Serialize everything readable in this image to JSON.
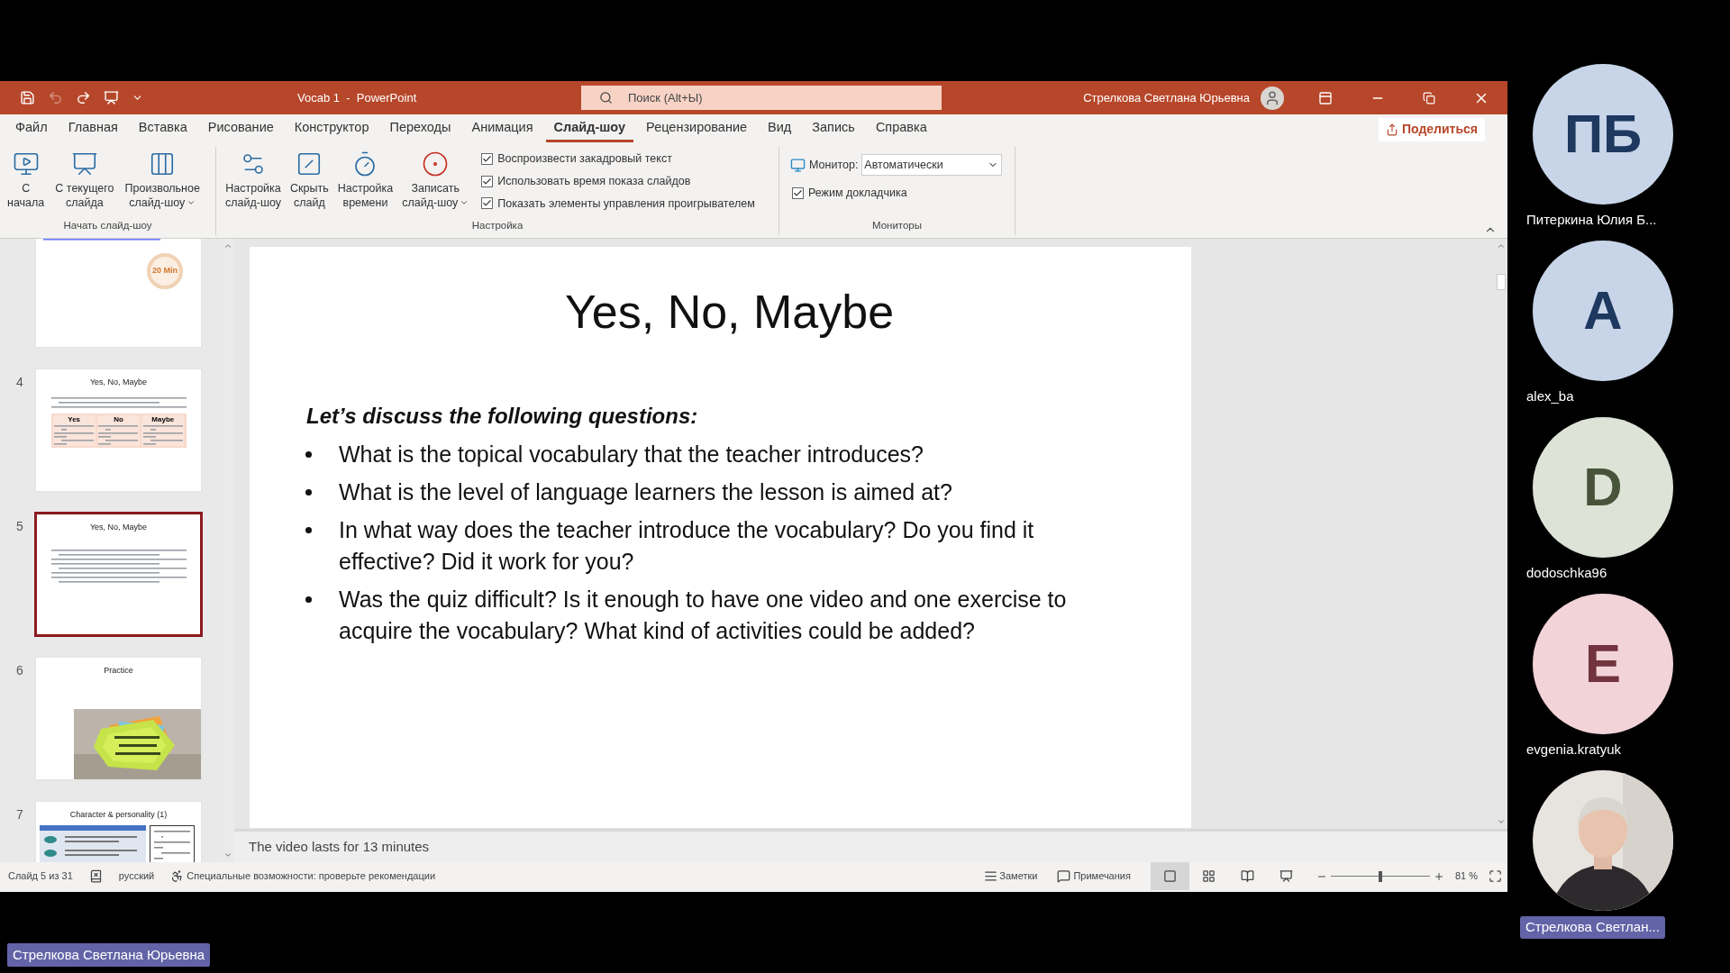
{
  "window": {
    "title": "Vocab 1  -  PowerPoint",
    "search": {
      "placeholder": "Поиск (Alt+Ы)"
    },
    "user": "Стрелкова Светлана Юрьевна"
  },
  "menu_tabs": [
    {
      "label": "Файл",
      "selected": false
    },
    {
      "label": "Главная",
      "selected": false
    },
    {
      "label": "Вставка",
      "selected": false
    },
    {
      "label": "Рисование",
      "selected": false
    },
    {
      "label": "Конструктор",
      "selected": false
    },
    {
      "label": "Переходы",
      "selected": false
    },
    {
      "label": "Анимация",
      "selected": false
    },
    {
      "label": "Слайд-шоу",
      "selected": true
    },
    {
      "label": "Рецензирование",
      "selected": false
    },
    {
      "label": "Вид",
      "selected": false
    },
    {
      "label": "Запись",
      "selected": false
    },
    {
      "label": "Справка",
      "selected": false
    }
  ],
  "share_button": "Поделиться",
  "ribbon": {
    "start_group": {
      "label": "Начать слайд-шоу",
      "buttons": [
        {
          "kind": "from-start",
          "lines": [
            "С",
            "начала"
          ],
          "has_menu": false
        },
        {
          "kind": "from-current",
          "lines": [
            "С текущего",
            "слайда"
          ],
          "has_menu": false
        },
        {
          "kind": "custom",
          "lines": [
            "Произвольное",
            "слайд-шоу"
          ],
          "has_menu": true
        }
      ]
    },
    "setup_group": {
      "label": "Настройка",
      "buttons": [
        {
          "kind": "setup",
          "lines": [
            "Настройка",
            "слайд-шоу"
          ],
          "has_menu": false
        },
        {
          "kind": "hide",
          "lines": [
            "Скрыть",
            "слайд"
          ],
          "has_menu": false
        },
        {
          "kind": "timing",
          "lines": [
            "Настройка",
            "времени"
          ],
          "has_menu": false
        },
        {
          "kind": "record",
          "lines": [
            "Записать",
            "слайд-шоу"
          ],
          "has_menu": true
        }
      ],
      "checkboxes": [
        {
          "label": "Воспроизвести закадровый текст",
          "checked": true
        },
        {
          "label": "Использовать время показа слайдов",
          "checked": true
        },
        {
          "label": "Показать элементы управления проигрывателем",
          "checked": true
        }
      ]
    },
    "monitors_group": {
      "label": "Мониторы",
      "monitor_label": "Монитор:",
      "monitor_value": "Автоматически",
      "presenter_view": {
        "label": "Режим докладчика",
        "checked": true
      }
    }
  },
  "thumbnails": [
    {
      "kind": "timer",
      "badge": "20 Min",
      "selected": false
    },
    {
      "kind": "table",
      "number": "4",
      "title": "Yes, No, Maybe",
      "table_headers": [
        "Yes",
        "No",
        "Maybe"
      ],
      "selected": false
    },
    {
      "kind": "questions",
      "number": "5",
      "title": "Yes, No, Maybe",
      "selected": true
    },
    {
      "number": "6",
      "title": "Practice",
      "selected": false
    },
    {
      "kind": "grid",
      "number": "7",
      "title": "Character & personality (1)",
      "selected": false
    }
  ],
  "slide": {
    "title": "Yes, No, Maybe",
    "lead": "Let’s discuss the following questions:",
    "bullets": [
      "What is the topical vocabulary that the teacher introduces?",
      "What is the level of language learners the lesson is aimed at?",
      "In what way does the teacher introduce the vocabulary? Do you find it effective? Did it work for you?",
      "Was the quiz difficult? Is it enough to have one video and one exercise to acquire the vocabulary? What kind of activities could be added?"
    ]
  },
  "notes": "The video lasts for 13 minutes",
  "status_bar": {
    "slide": "Слайд 5 из 31",
    "language": "русский",
    "accessibility": "Специальные возможности: проверьте рекомендации",
    "notes": "Заметки",
    "comments": "Примечания",
    "views": [
      {
        "kind": "normal",
        "selected": true
      },
      {
        "kind": "sorter",
        "selected": false
      },
      {
        "kind": "reading",
        "selected": false
      },
      {
        "kind": "slideshow",
        "selected": false
      }
    ],
    "zoom": {
      "label": "81 %",
      "level": 0.5
    }
  },
  "participants": [
    {
      "kind": "initials",
      "initials": "ПБ",
      "name": "Питеркина Юлия Б...",
      "color": "#c8d5e9",
      "highlighted": false
    },
    {
      "kind": "initials",
      "initials": "A",
      "name": "alex_ba",
      "color": "#c8d5e9",
      "highlighted": false
    },
    {
      "kind": "initials",
      "initials": "D",
      "name": "dodoschka96",
      "color": "#dde3d6",
      "highlighted": false
    },
    {
      "kind": "initials",
      "initials": "E",
      "name": "evgenia.kratyuk",
      "color": "#f2d3d8",
      "highlighted": false
    },
    {
      "kind": "video",
      "name": "Стрелкова Светлан...",
      "highlighted": true
    }
  ],
  "presenter_label": "Стрелкова Светлана Юрьевна"
}
